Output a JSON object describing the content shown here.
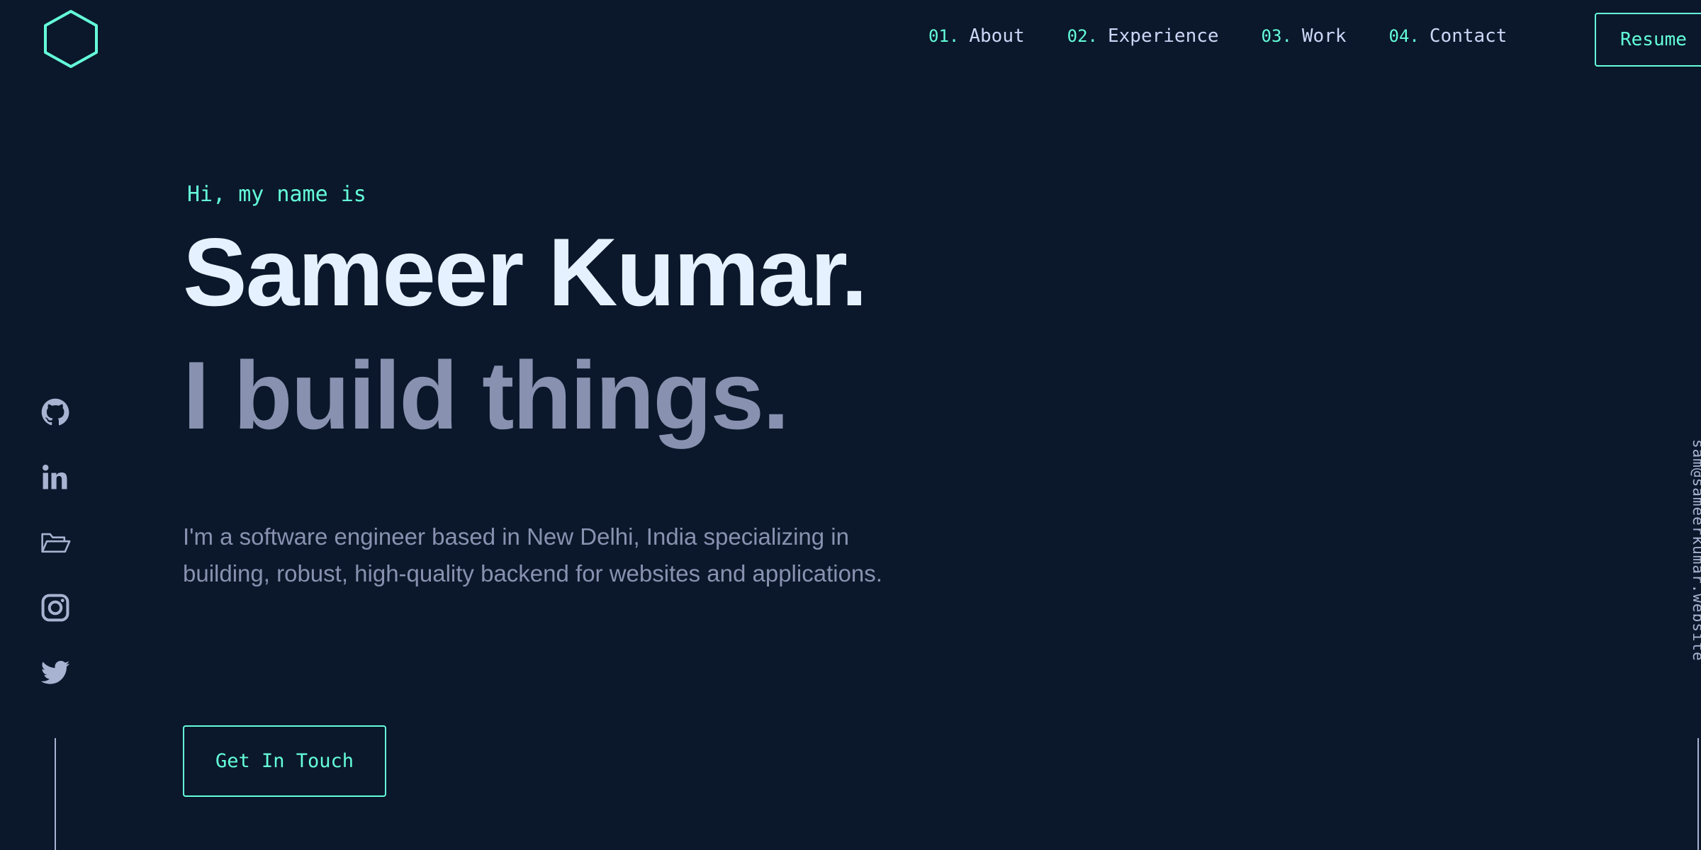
{
  "header": {
    "logo_icon": "hexagon-logo-icon",
    "nav": [
      {
        "number": "01.",
        "label": "About"
      },
      {
        "number": "02.",
        "label": "Experience"
      },
      {
        "number": "03.",
        "label": "Work"
      },
      {
        "number": "04.",
        "label": "Contact"
      }
    ],
    "resume_label": "Resume"
  },
  "hero": {
    "greeting": "Hi, my name is",
    "name": "Sameer Kumar.",
    "tagline": "I build things.",
    "description": "I'm a software engineer based in New Delhi, India specializing in building, robust, high-quality backend for websites and applications.",
    "cta_label": "Get In Touch"
  },
  "socials": [
    {
      "icon": "github-icon"
    },
    {
      "icon": "linkedin-icon"
    },
    {
      "icon": "folder-icon"
    },
    {
      "icon": "instagram-icon"
    },
    {
      "icon": "twitter-icon"
    }
  ],
  "side_email": "sam@sameerkumar.website",
  "colors": {
    "background": "#0b182b",
    "accent": "#64ffda",
    "heading": "#e6f1ff",
    "muted": "#8892b0",
    "nav_text": "#ccd6f6"
  }
}
